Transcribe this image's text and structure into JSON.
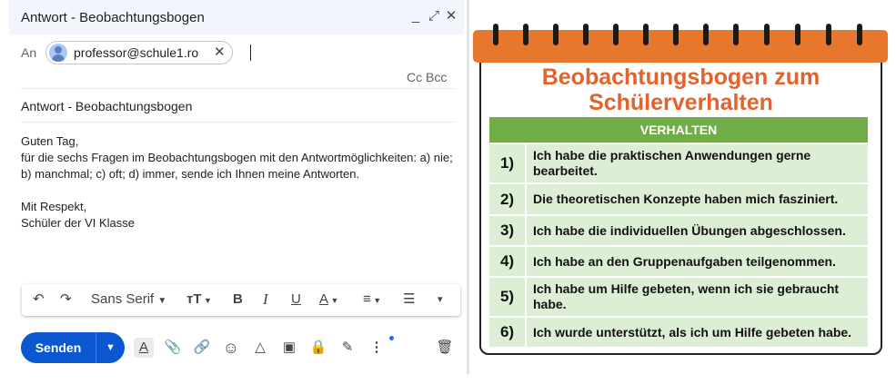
{
  "compose": {
    "title": "Antwort - Beobachtungsbogen",
    "window_buttons": {
      "minimize": "_",
      "expand": "⤢",
      "close": "✕"
    },
    "to_label": "An",
    "recipient": "professor@schule1.ro",
    "cc_bcc": "Cc Bcc",
    "subject": "Antwort - Beobachtungsbogen",
    "body_lines": [
      "Guten Tag,",
      "für die sechs Fragen im Beobachtungsbogen mit den Antwortmöglichkeiten: a) nie;",
      "b) manchmal; c) oft; d) immer, sende ich Ihnen meine Antworten.",
      "",
      "Mit Respekt,",
      "Schüler der VI Klasse"
    ],
    "format_toolbar": {
      "font": "Sans Serif",
      "undo_icon": "↶",
      "redo_icon": "↷",
      "font_size_icon": "тT",
      "bold": "B",
      "italic": "I",
      "underline": "U",
      "text_color": "A",
      "align_icon": "≡",
      "list_icon": "☰",
      "more_icon": "▾"
    },
    "send_label": "Senden",
    "send_more_icon": "▼",
    "bottom_tools": {
      "text_format": "A",
      "attach": "📎",
      "link": "🔗",
      "emoji": "☺",
      "drive": "△",
      "photo": "▣",
      "confidential": "🔒",
      "signature": "✎",
      "more": "⋮",
      "delete": "🗑"
    }
  },
  "card": {
    "title_line1": "Beobachtungsbogen zum",
    "title_line2": "Schülerverhalten",
    "header": "VERHALTEN",
    "colors": {
      "title": "#e2632b",
      "top_bar": "#e8772e",
      "header": "#70ad47",
      "row": "#dcefd4"
    },
    "questions": [
      {
        "num": "1)",
        "text_lines": [
          "Ich habe die praktischen Anwendungen gerne",
          "bearbeitet."
        ]
      },
      {
        "num": "2)",
        "text_lines": [
          "Die theoretischen Konzepte haben mich fasziniert."
        ]
      },
      {
        "num": "3)",
        "text_lines": [
          "Ich habe die individuellen Übungen abgeschlossen."
        ]
      },
      {
        "num": "4)",
        "text_lines": [
          "Ich habe an den Gruppenaufgaben teilgenommen."
        ]
      },
      {
        "num": "5)",
        "text_lines": [
          "Ich habe um Hilfe gebeten, wenn ich sie gebraucht",
          "habe."
        ]
      },
      {
        "num": "6)",
        "text_lines": [
          "Ich wurde unterstützt, als ich um Hilfe gebeten habe."
        ]
      }
    ]
  }
}
